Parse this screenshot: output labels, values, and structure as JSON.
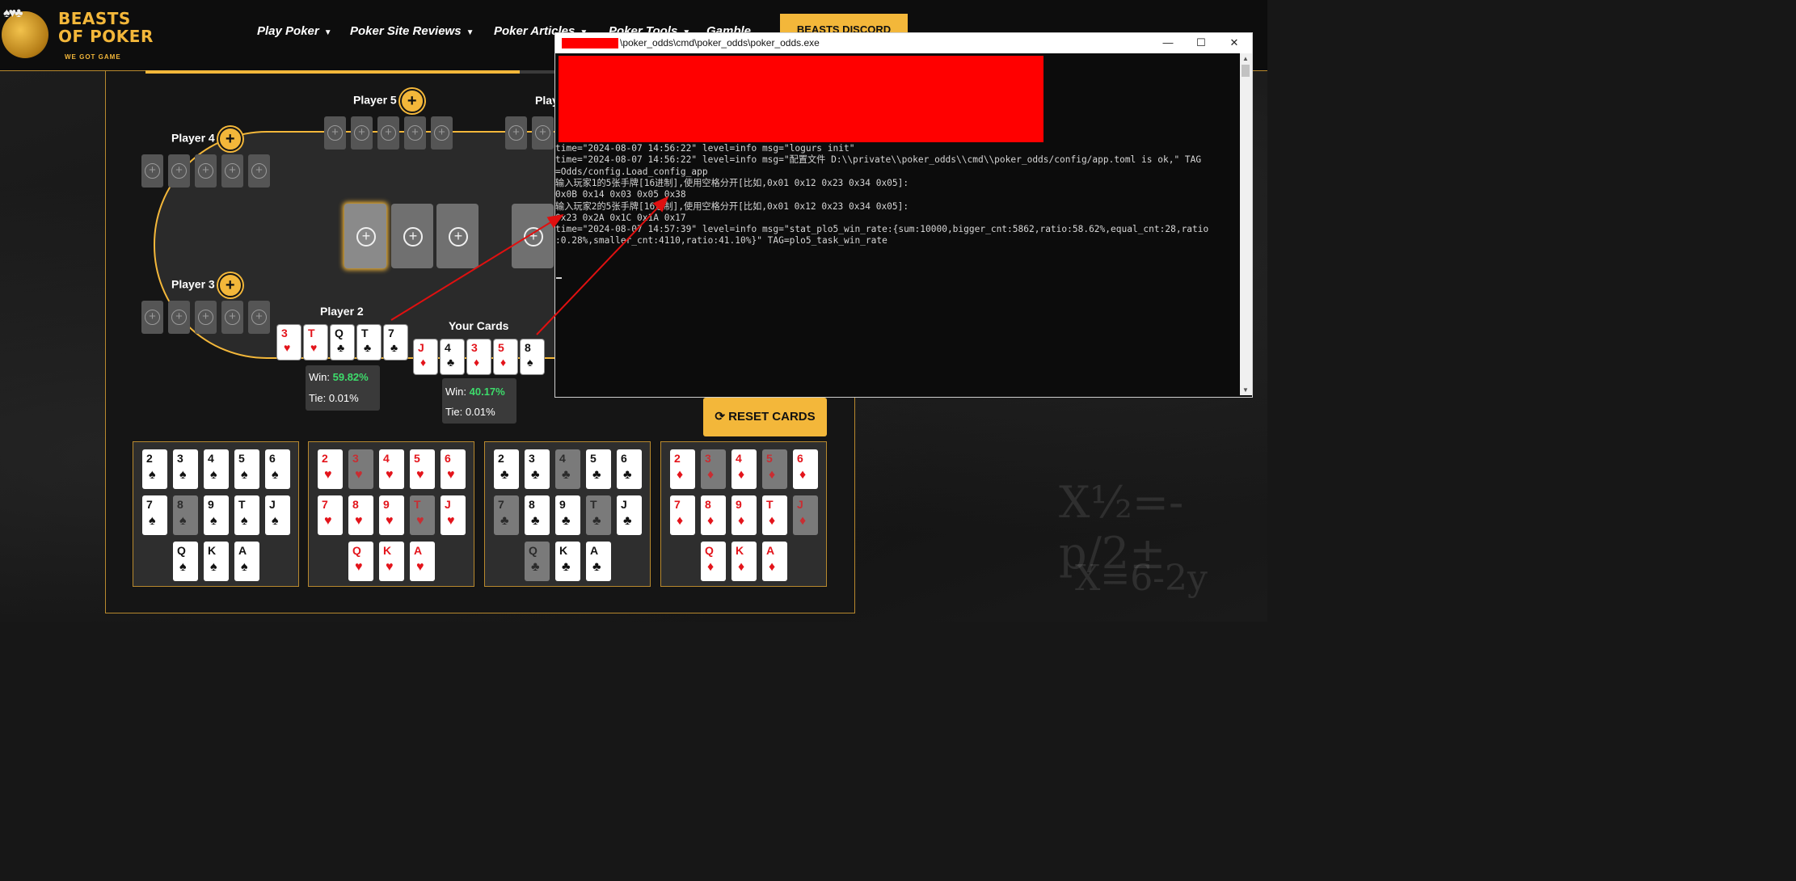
{
  "header": {
    "logo_title": "BEASTS\nOF POKER",
    "logo_tagline": "WE GOT GAME",
    "nav": [
      {
        "label": "Play Poker"
      },
      {
        "label": "Poker Site Reviews"
      },
      {
        "label": "Poker Articles"
      },
      {
        "label": "Poker Tools"
      },
      {
        "label": "Gamble"
      }
    ],
    "discord_label": "BEASTS DISCORD"
  },
  "table": {
    "players": {
      "player5": "Player 5",
      "player6_partial": "Play",
      "player4": "Player 4",
      "player3": "Player 3",
      "player2": "Player 2",
      "you": "Your Cards"
    },
    "player2_cards": [
      {
        "rank": "3",
        "suit": "♥",
        "color": "red"
      },
      {
        "rank": "T",
        "suit": "♥",
        "color": "red"
      },
      {
        "rank": "Q",
        "suit": "♣",
        "color": "black"
      },
      {
        "rank": "T",
        "suit": "♣",
        "color": "black"
      },
      {
        "rank": "7",
        "suit": "♣",
        "color": "black"
      }
    ],
    "your_cards": [
      {
        "rank": "J",
        "suit": "♦",
        "color": "red"
      },
      {
        "rank": "4",
        "suit": "♣",
        "color": "black"
      },
      {
        "rank": "3",
        "suit": "♦",
        "color": "red"
      },
      {
        "rank": "5",
        "suit": "♦",
        "color": "red"
      },
      {
        "rank": "8",
        "suit": "♠",
        "color": "black"
      }
    ],
    "player2_odds": {
      "win_label": "Win:",
      "win": "59.82%",
      "tie_label": "Tie:",
      "tie": "0.01%"
    },
    "your_odds": {
      "win_label": "Win:",
      "win": "40.17%",
      "tie_label": "Tie:",
      "tie": "0.01%"
    },
    "plus_symbol": "+",
    "reset_label": "RESET CARDS",
    "reset_icon": "refresh-icon",
    "progress_fraction": 0.89
  },
  "deck": {
    "spades": {
      "suit": "♠",
      "color": "black",
      "ranks": [
        "2",
        "3",
        "4",
        "5",
        "6",
        "7",
        "8",
        "9",
        "T",
        "J",
        "Q",
        "K",
        "A"
      ],
      "used": [
        "8"
      ]
    },
    "hearts": {
      "suit": "♥",
      "color": "red",
      "ranks": [
        "2",
        "3",
        "4",
        "5",
        "6",
        "7",
        "8",
        "9",
        "T",
        "J",
        "Q",
        "K",
        "A"
      ],
      "used": [
        "3",
        "T"
      ]
    },
    "clubs": {
      "suit": "♣",
      "color": "black",
      "ranks": [
        "2",
        "3",
        "4",
        "5",
        "6",
        "7",
        "8",
        "9",
        "T",
        "J",
        "Q",
        "K",
        "A"
      ],
      "used": [
        "4",
        "7",
        "T",
        "Q"
      ]
    },
    "diamonds": {
      "suit": "♦",
      "color": "red",
      "ranks": [
        "2",
        "3",
        "4",
        "5",
        "6",
        "7",
        "8",
        "9",
        "T",
        "J",
        "Q",
        "K",
        "A"
      ],
      "used": [
        "3",
        "5",
        "J"
      ]
    }
  },
  "console": {
    "title": "\\poker_odds\\cmd\\poker_odds\\poker_odds.exe",
    "buttons": {
      "minimize": "—",
      "maximize": "☐",
      "close": "✕"
    },
    "lines": [
      "time=\"2024-08-07 14:56:22\" level=info msg=\"logurs init\"",
      "time=\"2024-08-07 14:56:22\" level=info msg=\"配置文件 D:\\\\private\\\\poker_odds\\\\cmd\\\\poker_odds/config/app.toml is ok,\" TAG",
      "=Odds/config.Load_config_app",
      "输入玩家1的5张手牌[16进制],使用空格分开[比如,0x01 0x12 0x23 0x34 0x05]:",
      "0x0B 0x14 0x03 0x05 0x38",
      "输入玩家2的5张手牌[16进制],使用空格分开[比如,0x01 0x12 0x23 0x34 0x05]:",
      "0x23 0x2A 0x1C 0x1A 0x17",
      "time=\"2024-08-07 14:57:39\" level=info msg=\"stat_plo5_win_rate:{sum:10000,bigger_cnt:5862,ratio:58.62%,equal_cnt:28,ratio",
      ":0.28%,smaller_cnt:4110,ratio:41.10%}\" TAG=plo5_task_win_rate"
    ]
  },
  "colors": {
    "accent": "#f3b73a",
    "win_green": "#3ddc6b",
    "card_red": "#e3141b",
    "annotation_arrow": "#e01010"
  }
}
